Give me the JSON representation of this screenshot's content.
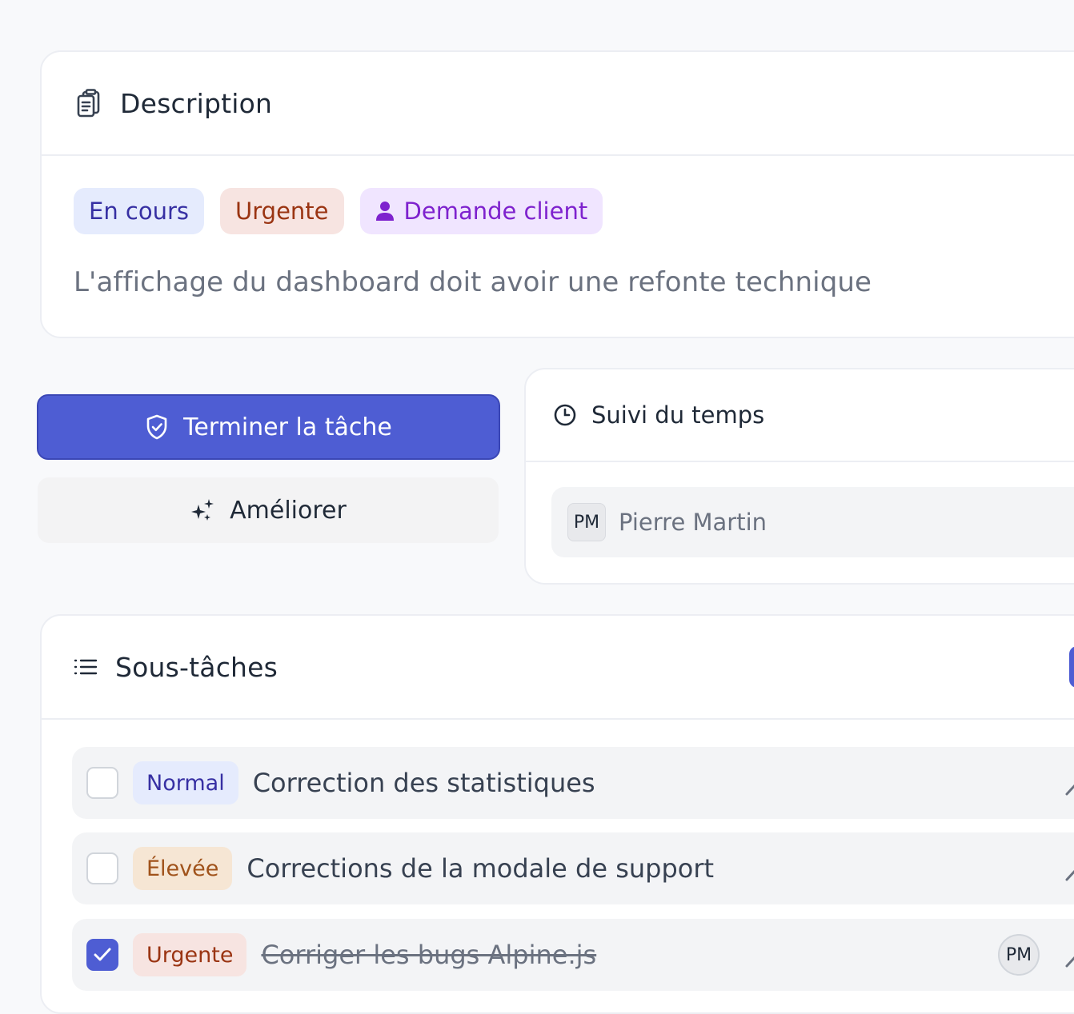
{
  "description": {
    "title": "Description",
    "title_icon": "clipboard-icon",
    "badges": {
      "status": "En cours",
      "priority": "Urgente",
      "type": "Demande client",
      "type_icon": "user-icon"
    },
    "text": "L'affichage du dashboard doit avoir une refonte technique"
  },
  "actions": {
    "complete_label": "Terminer la tâche",
    "complete_icon": "shield-check-icon",
    "improve_label": "Améliorer",
    "improve_icon": "sparkles-icon"
  },
  "time_tracking": {
    "title": "Suivi du temps",
    "title_icon": "clock-icon",
    "user_initials": "PM",
    "user_name": "Pierre Martin"
  },
  "subtasks": {
    "title": "Sous-tâches",
    "title_icon": "list-icon",
    "items": [
      {
        "checked": false,
        "priority": "Normal",
        "title": "Correction des statistiques"
      },
      {
        "checked": false,
        "priority": "Élevée",
        "title": "Corrections de la modale de support"
      },
      {
        "checked": true,
        "priority": "Urgente",
        "title": "Corriger les bugs Alpine.js",
        "assignee": "PM"
      }
    ]
  },
  "colors": {
    "primary": "#4e5dd3",
    "status_badge_bg": "#e5ebfd",
    "urgent_badge_bg": "#f7e4e1",
    "type_badge_bg": "#f0e5ff",
    "high_badge_bg": "#f6e6d4"
  }
}
